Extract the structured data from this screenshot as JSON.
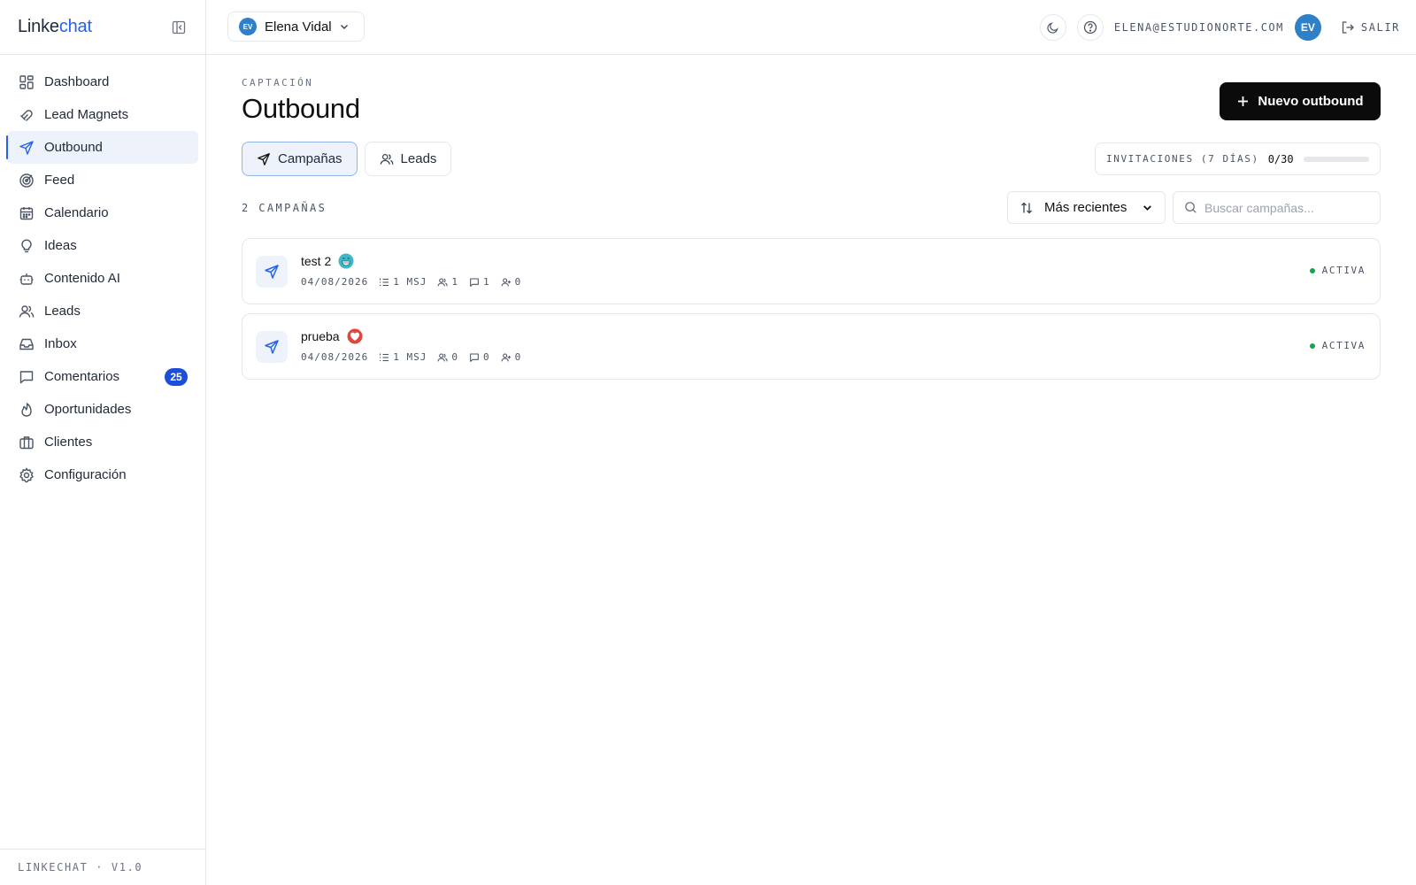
{
  "brand": {
    "part1": "Linke",
    "part2": "chat"
  },
  "sidebar": {
    "items": [
      {
        "label": "Dashboard",
        "icon": "grid-icon"
      },
      {
        "label": "Lead Magnets",
        "icon": "magnet-icon"
      },
      {
        "label": "Outbound",
        "icon": "send-icon",
        "active": true
      },
      {
        "label": "Feed",
        "icon": "radar-icon"
      },
      {
        "label": "Calendario",
        "icon": "calendar-icon"
      },
      {
        "label": "Ideas",
        "icon": "lightbulb-icon"
      },
      {
        "label": "Contenido AI",
        "icon": "bot-icon"
      },
      {
        "label": "Leads",
        "icon": "users-icon"
      },
      {
        "label": "Inbox",
        "icon": "inbox-icon"
      },
      {
        "label": "Comentarios",
        "icon": "comment-icon",
        "badge": "25"
      },
      {
        "label": "Oportunidades",
        "icon": "flame-icon"
      },
      {
        "label": "Clientes",
        "icon": "briefcase-icon"
      },
      {
        "label": "Configuración",
        "icon": "gear-icon"
      }
    ],
    "footer": "LINKECHAT · V1.0"
  },
  "topbar": {
    "account_initials": "EV",
    "account_name": "Elena Vidal",
    "email": "ELENA@ESTUDIONORTE.COM",
    "user_initials": "EV",
    "logout_label": "SALIR"
  },
  "page": {
    "eyebrow": "CAPTACIÓN",
    "title": "Outbound",
    "new_button": "Nuevo outbound",
    "tabs": [
      {
        "label": "Campañas",
        "active": true
      },
      {
        "label": "Leads",
        "active": false
      }
    ],
    "invites": {
      "label": "INVITACIONES (7 DÍAS)",
      "value": "0/30",
      "fraction": 0
    },
    "count": "2 CAMPAÑAS",
    "sort_label": "Más recientes",
    "search_placeholder": "Buscar campañas..."
  },
  "campaigns": [
    {
      "name": "test 2",
      "emoji": "grinning-face-icon",
      "date": "04/08/2026",
      "messages": "1 MSJ",
      "leads": "1",
      "comments": "1",
      "connections": "0",
      "status": "ACTIVA"
    },
    {
      "name": "prueba",
      "emoji": "heart-icon",
      "date": "04/08/2026",
      "messages": "1 MSJ",
      "leads": "0",
      "comments": "0",
      "connections": "0",
      "status": "ACTIVA"
    }
  ],
  "colors": {
    "accent": "#2563eb",
    "active_bg": "#eef2fb",
    "badge": "#1d4ed8",
    "avatar": "#2f80c8",
    "status_active": "#16a34a",
    "primary_button": "#0b0b0b"
  }
}
